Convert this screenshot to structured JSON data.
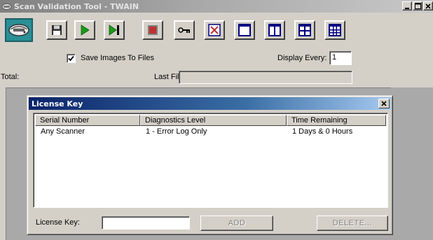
{
  "window": {
    "title": "Scan Validation Tool - TWAIN",
    "minimize_label": "_",
    "restore_label": "□",
    "close_label": "×"
  },
  "toolbar": {
    "buttons": [
      {
        "name": "scanner-setup",
        "icon": "scanner-icon"
      },
      {
        "name": "save",
        "icon": "floppy-disk-icon"
      },
      {
        "name": "start",
        "icon": "play-icon"
      },
      {
        "name": "scan-one",
        "icon": "step-forward-icon"
      },
      {
        "name": "stop",
        "icon": "stop-icon"
      },
      {
        "name": "license-key",
        "icon": "key-icon"
      },
      {
        "name": "no-display",
        "icon": "x-box-icon"
      },
      {
        "name": "single-view",
        "icon": "single-pane-icon"
      },
      {
        "name": "dual-view",
        "icon": "dual-pane-icon"
      },
      {
        "name": "quad-view",
        "icon": "quad-pane-icon"
      },
      {
        "name": "multi-view",
        "icon": "grid-pane-icon"
      }
    ]
  },
  "options": {
    "save_images_label": "Save Images To Files",
    "save_images_checked": true,
    "display_every_label": "Display Every:",
    "display_every_value": "1",
    "total_label": "Total:",
    "last_file_label": "Last File:",
    "last_file_value": ""
  },
  "dialog": {
    "title": "License Key",
    "close_label": "×",
    "columns": [
      "Serial Number",
      "Diagnostics Level",
      "Time Remaining"
    ],
    "rows": [
      [
        "Any Scanner",
        "1 - Error Log Only",
        "1 Days & 0 Hours"
      ]
    ],
    "license_key_label": "License Key:",
    "license_key_value": "",
    "add_label": "ADD",
    "delete_label": "DELETE..."
  },
  "colors": {
    "dialog_title_start": "#0a246a",
    "dialog_title_end": "#a6caf0",
    "play_green": "#1a9a1a",
    "stop_red": "#c03030",
    "view_blue": "#000080",
    "content_gray": "#a9a9a9"
  }
}
